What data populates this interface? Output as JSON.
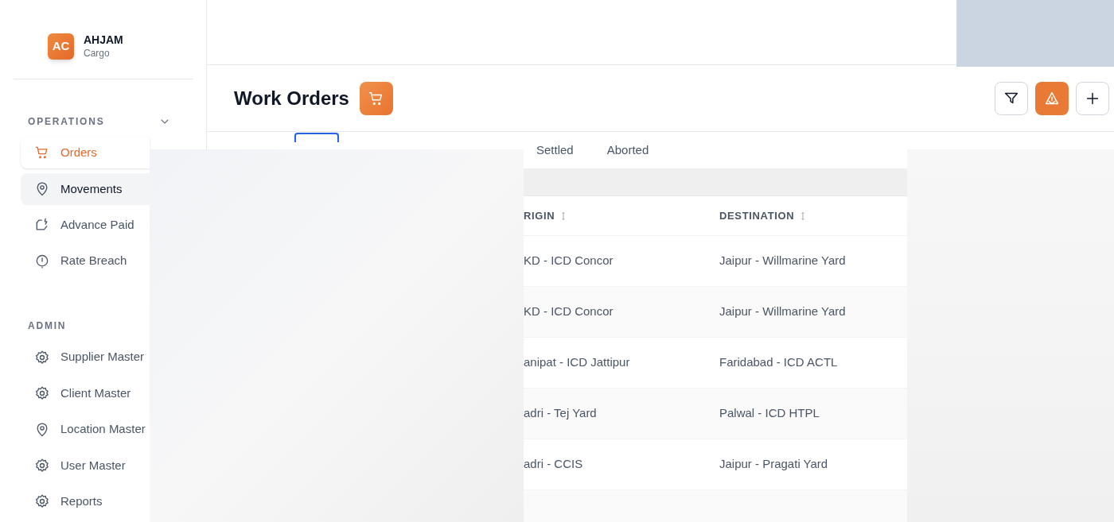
{
  "brand": {
    "initials": "AC",
    "name": "AHJAM",
    "subtitle": "Cargo"
  },
  "sections": [
    {
      "title": "OPERATIONS",
      "expanded": true,
      "items": [
        {
          "label": "Orders",
          "selected": true,
          "hovered": false
        },
        {
          "label": "Movements",
          "selected": false,
          "hovered": true
        },
        {
          "label": "Advance Paid",
          "selected": false,
          "hovered": false
        },
        {
          "label": "Rate Breach",
          "selected": false,
          "hovered": false
        }
      ]
    },
    {
      "title": "ADMIN",
      "items": [
        {
          "label": "Supplier Master",
          "selected": false,
          "hovered": false
        },
        {
          "label": "Client Master",
          "selected": false,
          "hovered": false
        },
        {
          "label": "Location Master",
          "selected": false,
          "hovered": false
        },
        {
          "label": "User Master",
          "selected": false,
          "hovered": false
        },
        {
          "label": "Reports",
          "selected": false,
          "hovered": false
        }
      ]
    }
  ],
  "page": {
    "title": "Work Orders"
  },
  "toolbar": [
    {
      "kind": "filter",
      "active": false
    },
    {
      "kind": "alert",
      "active": true
    },
    {
      "kind": "add",
      "active": false
    }
  ],
  "tabs": [
    {
      "label": "Settled",
      "selected": false
    },
    {
      "label": "Aborted",
      "selected": false
    }
  ],
  "table": {
    "columns": [
      "RIGIN",
      "DESTINATION"
    ],
    "rows": [
      [
        "KD - ICD Concor",
        "Jaipur - Willmarine Yard"
      ],
      [
        "KD - ICD Concor",
        "Jaipur - Willmarine Yard"
      ],
      [
        "anipat - ICD Jattipur",
        "Faridabad - ICD ACTL"
      ],
      [
        "adri - Tej Yard",
        "Palwal - ICD HTPL"
      ],
      [
        "adri - CCIS",
        "Jaipur - Pragati Yard"
      ]
    ]
  }
}
